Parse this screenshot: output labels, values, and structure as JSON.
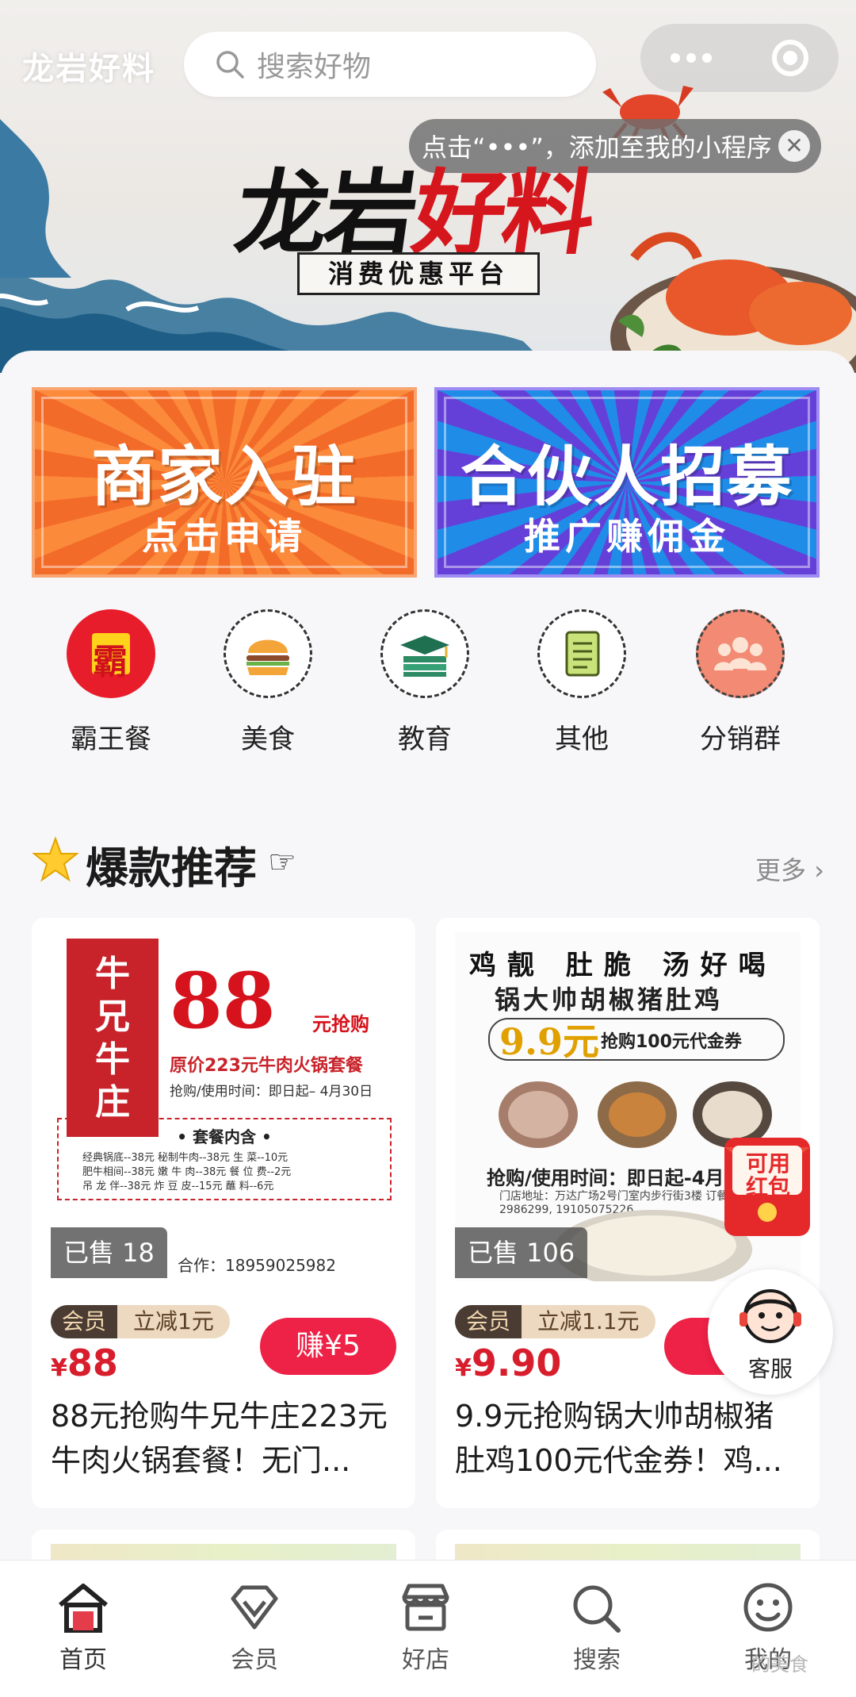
{
  "header": {
    "app_title": "龙岩好料",
    "search_placeholder": "搜索好物",
    "tip_text": "点击“•••”，添加至我的小程序",
    "tip_close": "✕"
  },
  "hero": {
    "logo_black": "龙岩",
    "logo_red": "好料",
    "logo_sub": "消费优惠平台"
  },
  "banners": [
    {
      "title": "商家入驻",
      "subtitle": "点击申请"
    },
    {
      "title": "合伙人招募",
      "subtitle": "推广赚佣金"
    }
  ],
  "categories": [
    {
      "label": "霸王餐",
      "icon": "bawang-icon",
      "icon_text": "霸"
    },
    {
      "label": "美食",
      "icon": "burger-icon"
    },
    {
      "label": "教育",
      "icon": "graduation-cap-icon"
    },
    {
      "label": "其他",
      "icon": "document-icon"
    },
    {
      "label": "分销群",
      "icon": "group-icon"
    }
  ],
  "section": {
    "title": "爆款推荐",
    "hand": "☞",
    "more": "更多 ›"
  },
  "products": [
    {
      "sold": "已售 18",
      "member_tag": "会员",
      "discount_tag": "立减1元",
      "currency": "¥",
      "price": "88",
      "earn": "赚¥5",
      "desc": "88元抢购牛兄牛庄223元牛肉火锅套餐！无门...",
      "poster": {
        "shop": "牛兄牛庄",
        "big_price": "88",
        "price_suffix": "元抢购",
        "original": "原价223元牛肉火锅套餐",
        "time": "抢购/使用时间：即日起– 4月30日",
        "set_title": "• 套餐内含 •",
        "rows": [
          "经典锅底--38元   秘制牛肉--38元   生 菜--10元",
          "肥牛相间--38元   嫩 牛 肉--38元   餐 位 费--2元",
          "吊 龙 伴--38元   炸 豆 皮--15元   蘸 料--6元"
        ],
        "footer": "合作：18959025982"
      }
    },
    {
      "sold": "已售 106",
      "member_tag": "会员",
      "discount_tag": "立减1.1元",
      "currency": "¥",
      "price": "9.90",
      "earn": "赚",
      "desc": "9.9元抢购锅大帅胡椒猪肚鸡100元代金券！鸡...",
      "poster": {
        "top": "鸡靓 肚脆 汤好喝",
        "title": "锅大帅胡椒猪肚鸡",
        "big_price": "9.9元",
        "voucher": "抢购100元代金券",
        "time": "抢购/使用时间：即日起-4月",
        "info": "门店地址：万达广场2号门室内步行街3楼  订餐热线：0597-2986299, 19105075226"
      }
    }
  ],
  "floating": {
    "redpack_text": "可用红包",
    "service_label": "客服"
  },
  "tabbar": [
    {
      "label": "首页",
      "icon": "home-icon",
      "active": true
    },
    {
      "label": "会员",
      "icon": "diamond-icon"
    },
    {
      "label": "好店",
      "icon": "shop-icon"
    },
    {
      "label": "搜索",
      "icon": "search-icon"
    },
    {
      "label": "我的",
      "icon": "smiley-icon"
    }
  ],
  "watermark": "的美食",
  "colors": {
    "accent_red": "#ee2146",
    "price_red": "#d81e2d",
    "banner_orange": "#f36b28",
    "banner_blue": "#4a62e6"
  }
}
